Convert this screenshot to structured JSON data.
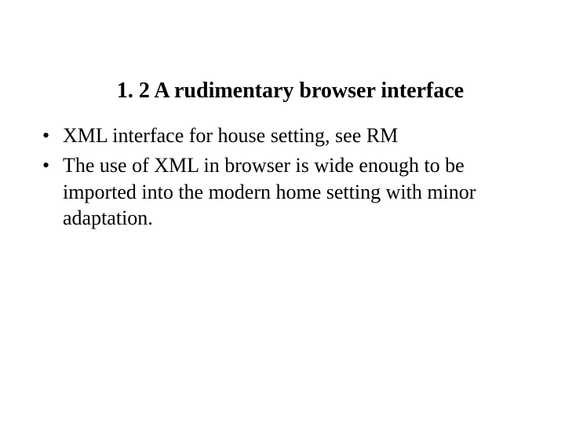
{
  "heading": "1. 2  A rudimentary browser interface",
  "bullets": [
    "XML interface for house setting, see RM",
    "The use of XML in browser is wide enough to be imported into the modern home setting with minor adaptation."
  ]
}
